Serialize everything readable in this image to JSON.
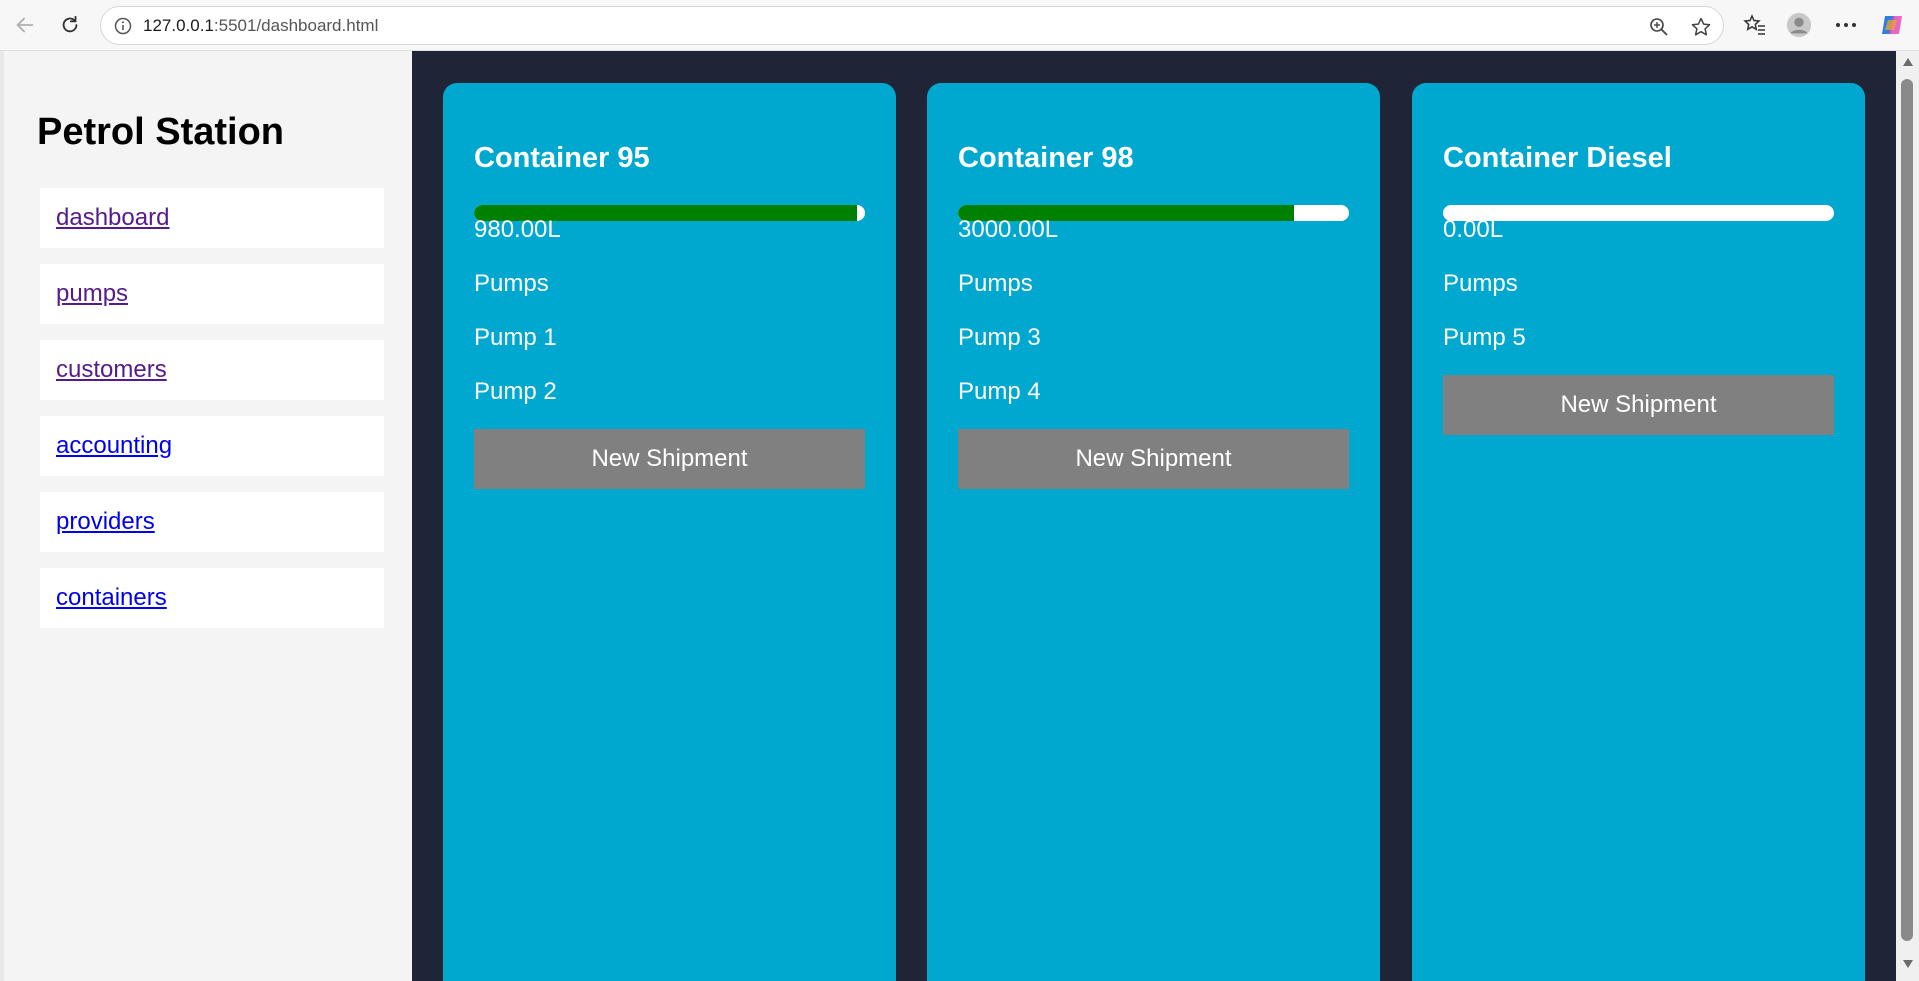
{
  "browser": {
    "url_host": "127.0.0.1",
    "url_rest": ":5501/dashboard.html"
  },
  "sidebar": {
    "title": "Petrol Station",
    "items": [
      {
        "label": "dashboard",
        "visited": true
      },
      {
        "label": "pumps",
        "visited": true
      },
      {
        "label": "customers",
        "visited": true
      },
      {
        "label": "accounting",
        "visited": false
      },
      {
        "label": "providers",
        "visited": false
      },
      {
        "label": "containers",
        "visited": false
      }
    ]
  },
  "containers": [
    {
      "title": "Container 95",
      "level_fraction": 0.98,
      "amount": "980.00L",
      "pumps_heading": "Pumps",
      "pumps": [
        "Pump 1",
        "Pump 2"
      ],
      "button_label": "New Shipment"
    },
    {
      "title": "Container 98",
      "level_fraction": 0.86,
      "amount": "3000.00L",
      "pumps_heading": "Pumps",
      "pumps": [
        "Pump 3",
        "Pump 4"
      ],
      "button_label": "New Shipment"
    },
    {
      "title": "Container Diesel",
      "level_fraction": 0.0,
      "amount": "0.00L",
      "pumps_heading": "Pumps",
      "pumps": [
        "Pump 5"
      ],
      "button_label": "New Shipment"
    }
  ],
  "colors": {
    "card_bg": "#00a8d0",
    "main_bg": "#1f2536",
    "progress_fill": "#008000",
    "button_bg": "#808080"
  }
}
